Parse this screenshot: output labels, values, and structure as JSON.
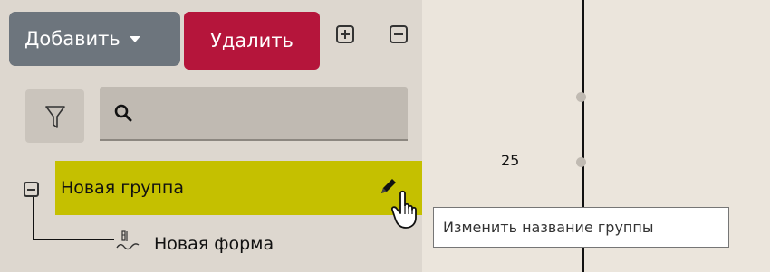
{
  "toolbar": {
    "add_label": "Добавить",
    "delete_label": "Удалить"
  },
  "search": {
    "value": ""
  },
  "tree": {
    "group_label": "Новая группа",
    "form_label": "Новая форма"
  },
  "canvas": {
    "number_label": "25"
  },
  "tooltip": {
    "text": "Изменить название группы"
  },
  "colors": {
    "panel_bg": "#ddd7cf",
    "canvas_bg": "#ebe5dc",
    "add_button": "#6d757d",
    "delete_button": "#b5153b",
    "selected_row": "#c5c000",
    "search_bg": "#c0bab2"
  }
}
